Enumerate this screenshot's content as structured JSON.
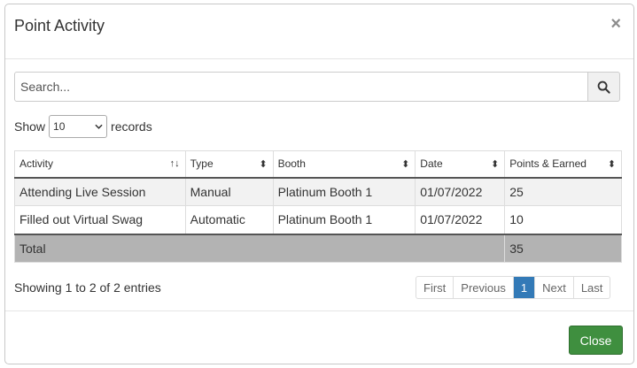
{
  "modal": {
    "title": "Point Activity",
    "close_glyph": "×"
  },
  "search": {
    "placeholder": "Search...",
    "icon": "search-icon"
  },
  "length": {
    "prefix": "Show",
    "value": "10",
    "suffix": "records"
  },
  "table": {
    "headers": [
      "Activity",
      "Type",
      "Booth",
      "Date",
      "Points & Earned"
    ],
    "rows": [
      [
        "Attending Live Session",
        "Manual",
        "Platinum Booth 1",
        "01/07/2022",
        "25"
      ],
      [
        "Filled out Virtual Swag",
        "Automatic",
        "Platinum Booth 1",
        "01/07/2022",
        "10"
      ]
    ],
    "footer": {
      "label": "Total",
      "value": "35"
    }
  },
  "info": "Showing 1 to 2 of 2 entries",
  "pagination": {
    "first": "First",
    "previous": "Previous",
    "current": "1",
    "next": "Next",
    "last": "Last"
  },
  "footer": {
    "close_label": "Close",
    "close_color": "#3f8f3f"
  },
  "colors": {
    "active_page": "#337ab7",
    "total_row": "#b3b3b3"
  }
}
